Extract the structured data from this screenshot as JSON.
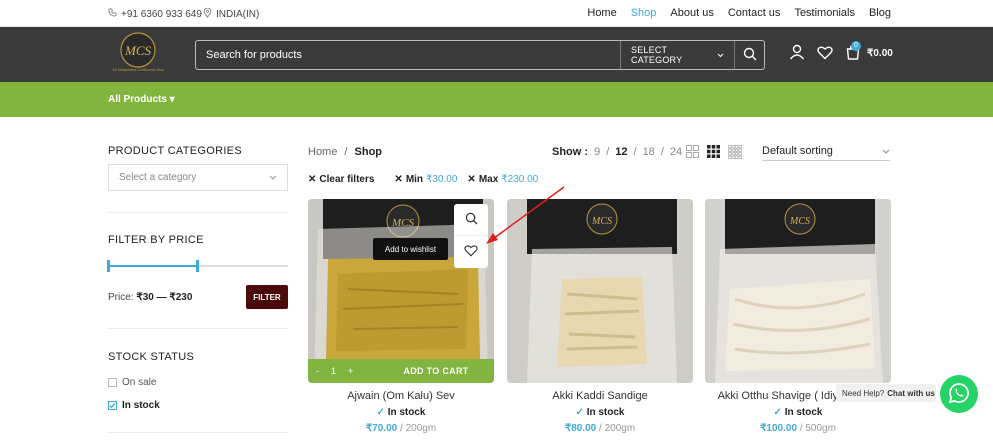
{
  "topbar": {
    "phone": "+91 6360 933 649",
    "region": "INDIA(IN)",
    "nav": [
      "Home",
      "Shop",
      "About us",
      "Contact us",
      "Testimonials",
      "Blog"
    ],
    "active_nav": "Shop"
  },
  "header": {
    "search_placeholder": "Search for products",
    "category_label": "SELECT CATEGORY",
    "cart_count": "0",
    "cart_total": "₹0.00"
  },
  "greenbar": {
    "all_products": "All Products ▾"
  },
  "sidebar": {
    "categories_title": "PRODUCT CATEGORIES",
    "category_select": "Select a category",
    "price_title": "FILTER BY PRICE",
    "price_label": "Price:",
    "price_range": "₹30 — ₹230",
    "filter_button": "FILTER",
    "stock_title": "STOCK STATUS",
    "stock_options": [
      {
        "label": "On sale",
        "checked": false
      },
      {
        "label": "In stock",
        "checked": true
      }
    ]
  },
  "toolbar": {
    "breadcrumb_home": "Home",
    "breadcrumb_sep": "/",
    "breadcrumb_current": "Shop",
    "show_label": "Show :",
    "show_options": [
      "9",
      "12",
      "18",
      "24"
    ],
    "show_selected": "12",
    "sorting": "Default sorting",
    "clear_filters": "Clear filters",
    "min_label": "Min",
    "min_value": "₹30.00",
    "max_label": "Max",
    "max_value": "₹230.00"
  },
  "products": [
    {
      "name": "Ajwain (Om Kalu) Sev",
      "stock": "In stock",
      "price": "₹70.00",
      "unit": "/ 200gm"
    },
    {
      "name": "Akki Kaddi Sandige",
      "stock": "In stock",
      "price": "₹80.00",
      "unit": "/ 200gm"
    },
    {
      "name": "Akki Otthu Shavige ( Idiyappam )",
      "stock": "In stock",
      "price": "₹100.00",
      "unit": "/ 500gm"
    }
  ],
  "hover": {
    "tooltip": "Add to wishlist",
    "qty": "1",
    "minus": "-",
    "plus": "+",
    "add_to_cart": "ADD TO CART"
  },
  "whatsapp": {
    "need_help": "Need Help?",
    "chat": "Chat with us"
  },
  "colors": {
    "accent": "#3fa9d8",
    "green": "#82b440",
    "header": "#3a3a3a",
    "filter_btn": "#4a0a0a"
  }
}
